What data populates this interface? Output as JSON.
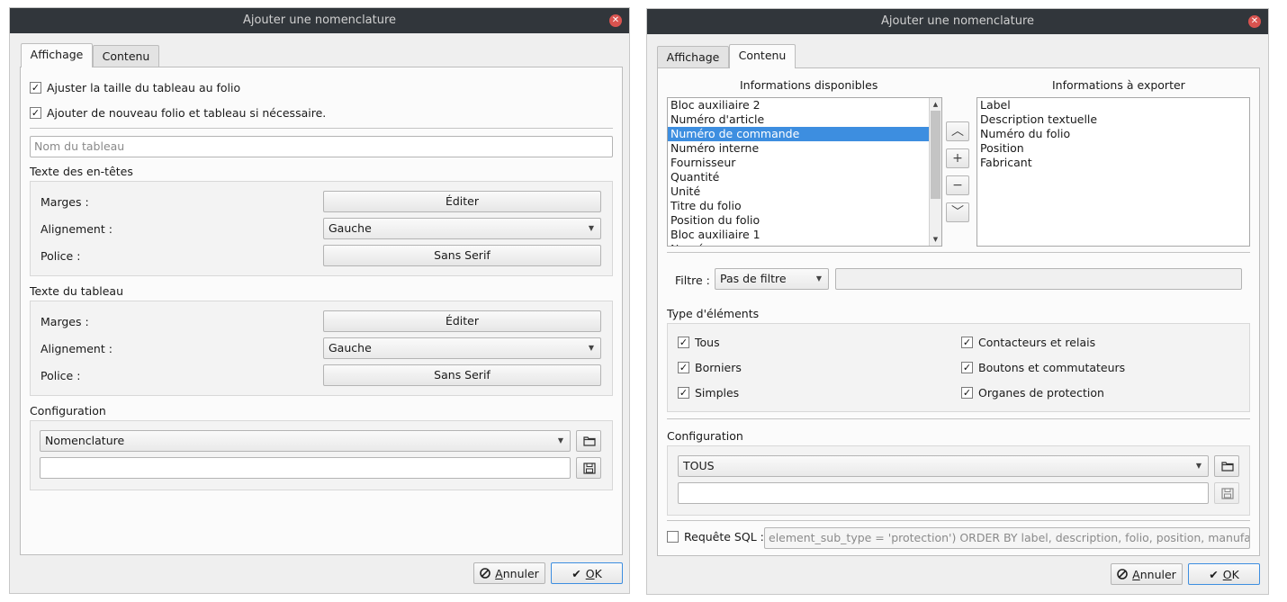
{
  "colors": {
    "titlebar": "#31363b",
    "close": "#d9534f",
    "selection": "#3d8ee0"
  },
  "dialog1": {
    "title": "Ajouter une nomenclature",
    "tabs": [
      "Affichage",
      "Contenu"
    ],
    "fit_table": "Ajuster la taille du tableau au folio",
    "add_folio": "Ajouter de nouveau folio et tableau si nécessaire.",
    "table_name_placeholder": "Nom du tableau",
    "headers_title": "Texte des en-têtes",
    "table_text_title": "Texte du tableau",
    "margins_label": "Marges :",
    "align_label": "Alignement :",
    "font_label": "Police :",
    "edit_btn": "Éditer",
    "align_value": "Gauche",
    "font_value": "Sans Serif",
    "config_title": "Configuration",
    "config_value": "Nomenclature",
    "cancel_prefix": "A",
    "cancel_rest": "nnuler",
    "ok_prefix": "O",
    "ok_rest": "K"
  },
  "dialog2": {
    "title": "Ajouter une nomenclature",
    "tabs": [
      "Affichage",
      "Contenu"
    ],
    "available_title": "Informations disponibles",
    "export_title": "Informations à exporter",
    "available_items": [
      "Bloc auxiliaire 2",
      "Numéro d'article",
      "Numéro de commande",
      "Numéro interne",
      "Fournisseur",
      "Quantité",
      "Unité",
      "Titre du folio",
      "Position du folio",
      "Bloc auxiliaire 1",
      "Numéro"
    ],
    "selected_index": 2,
    "export_items": [
      "Label",
      "Description textuelle",
      "Numéro du folio",
      "Position",
      "Fabricant"
    ],
    "filter_label": "Filtre :",
    "filter_value": "Pas de filtre",
    "types_title": "Type d'éléments",
    "type_all": "Tous",
    "type_contactors": "Contacteurs et relais",
    "type_terminals": "Borniers",
    "type_buttons": "Boutons et commutateurs",
    "type_simple": "Simples",
    "type_protection": "Organes de protection",
    "config_title": "Configuration",
    "config_value": "TOUS",
    "sql_label": "Requête SQL :",
    "sql_value": "element_sub_type = 'protection') ORDER BY label, description, folio, position, manufacturer",
    "cancel_prefix": "A",
    "cancel_rest": "nnuler",
    "ok_prefix": "O",
    "ok_rest": "K"
  },
  "icons": {
    "close": "×",
    "check": "✓",
    "up": "︿",
    "add": "+",
    "remove": "−",
    "down": "﹀",
    "dropdown": "▼"
  }
}
